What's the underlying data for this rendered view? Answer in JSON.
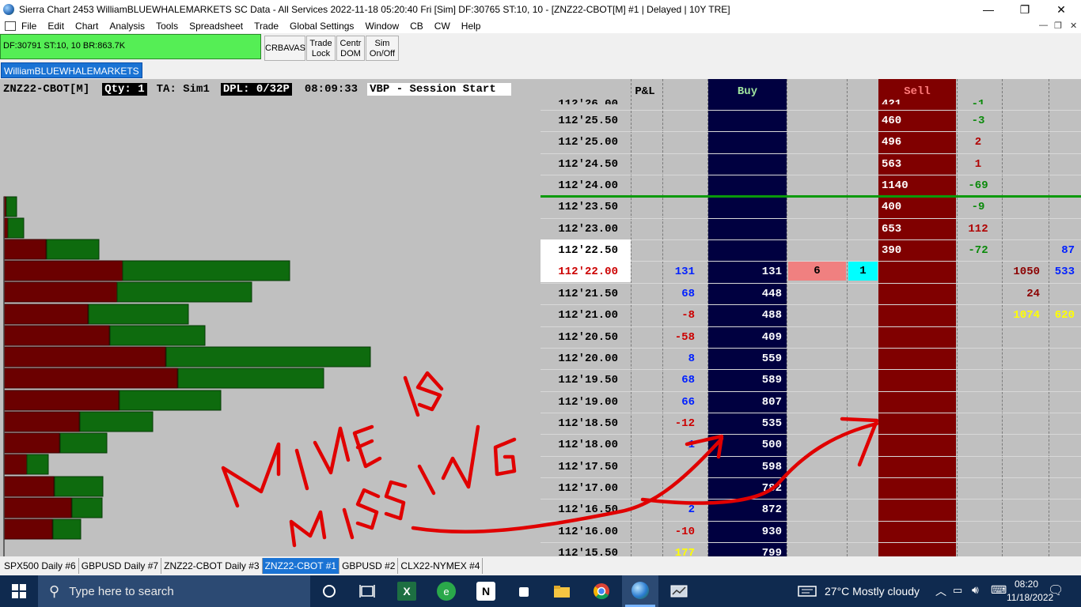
{
  "window": {
    "title": "Sierra Chart 2453 WilliamBLUEWHALEMARKETS  SC Data - All Services 2022-11-18  05:20:40 Fri [Sim]  DF:30765  ST:10, 10 - [ZNZ22-CBOT[M]  #1 | Delayed | 10Y TRE]",
    "minimize": "—",
    "restore": "❐",
    "close": "✕"
  },
  "menu": {
    "items": [
      "File",
      "Edit",
      "Chart",
      "Analysis",
      "Tools",
      "Spreadsheet",
      "Trade",
      "Global Settings",
      "Window",
      "CB",
      "CW",
      "Help"
    ],
    "mdi_min": "—",
    "mdi_restore": "❐",
    "mdi_close": "✕"
  },
  "toolbar": {
    "status": "DF:30791  ST:10, 10  BR:863.7K",
    "crbavas": "CRBAVAS",
    "trade_lock_1": "Trade",
    "trade_lock_2": "Lock",
    "centr_dom_1": "Centr",
    "centr_dom_2": "DOM",
    "sim_1": "Sim",
    "sim_2": "On/Off"
  },
  "account": {
    "name": "WilliamBLUEWHALEMARKETS"
  },
  "chart": {
    "symbol": "ZNZ22-CBOT[M]",
    "qty": "Qty: 1",
    "ta": "TA: Sim1",
    "dpl": "DPL: 0/32P",
    "time": "08:09:33",
    "study": "VBP - Session Start ",
    "headers": {
      "pnl": "P&L",
      "buy": "Buy",
      "sell": "Sell"
    },
    "top_price_partial": "112'26.00",
    "top_sell_partial": "421",
    "top_diff_partial": "-1",
    "rows": [
      {
        "price": "112'25.50",
        "sell": "460",
        "diff": "-3"
      },
      {
        "price": "112'25.00",
        "sell": "496",
        "diff": "2"
      },
      {
        "price": "112'24.50",
        "sell": "563",
        "diff": "1"
      },
      {
        "price": "112'24.00",
        "sell": "1140",
        "diff": "-69"
      },
      {
        "price": "112'23.50",
        "sell": "400",
        "diff": "-9"
      },
      {
        "price": "112'23.00",
        "sell": "653",
        "diff": "112"
      },
      {
        "price": "112'22.50",
        "sell": "390",
        "diff": "-72",
        "extra": "87"
      },
      {
        "price": "112'22.00",
        "pnl": "131",
        "buy": "131",
        "bid_order": "6",
        "bid_qty": "1",
        "sell_hist": "1050",
        "extra": "533"
      },
      {
        "price": "112'21.50",
        "pnl": "68",
        "buy": "448",
        "sell_hist": "24"
      },
      {
        "price": "112'21.00",
        "pnl": "-8",
        "buy": "488",
        "sell_hist": "1074",
        "extra": "620"
      },
      {
        "price": "112'20.50",
        "pnl": "-58",
        "buy": "409"
      },
      {
        "price": "112'20.00",
        "pnl": "8",
        "buy": "559"
      },
      {
        "price": "112'19.50",
        "pnl": "68",
        "buy": "589"
      },
      {
        "price": "112'19.00",
        "pnl": "66",
        "buy": "807"
      },
      {
        "price": "112'18.50",
        "pnl": "-12",
        "buy": "535"
      },
      {
        "price": "112'18.00",
        "pnl": "1",
        "buy": "500"
      },
      {
        "price": "112'17.50",
        "buy": "598"
      },
      {
        "price": "112'17.00",
        "buy": "782"
      },
      {
        "price": "112'16.50",
        "pnl": "2",
        "buy": "872"
      },
      {
        "price": "112'16.00",
        "pnl": "-10",
        "buy": "930"
      },
      {
        "price": "112'15.50",
        "pnl": "177",
        "buy": "799"
      }
    ],
    "annotation_1": "MINE IS",
    "annotation_2": "MISSING",
    "colors": {
      "buy_bg": "#000040",
      "sell_bg": "#800000",
      "vbp_red": "#6b0000",
      "vbp_green": "#0e6b0e",
      "annotation": "#e00000"
    }
  },
  "chart_tabs": [
    "SPX500  Daily  #6",
    "GBPUSD  Daily  #7",
    "ZNZ22-CBOT  Daily  #3",
    "ZNZ22-CBOT  #1",
    "GBPUSD  #2",
    "CLX22-NYMEX  #4"
  ],
  "taskbar": {
    "search_placeholder": "Type here to search",
    "weather": "27°C  Mostly cloudy",
    "time": "08:20",
    "date": "11/18/2022"
  }
}
